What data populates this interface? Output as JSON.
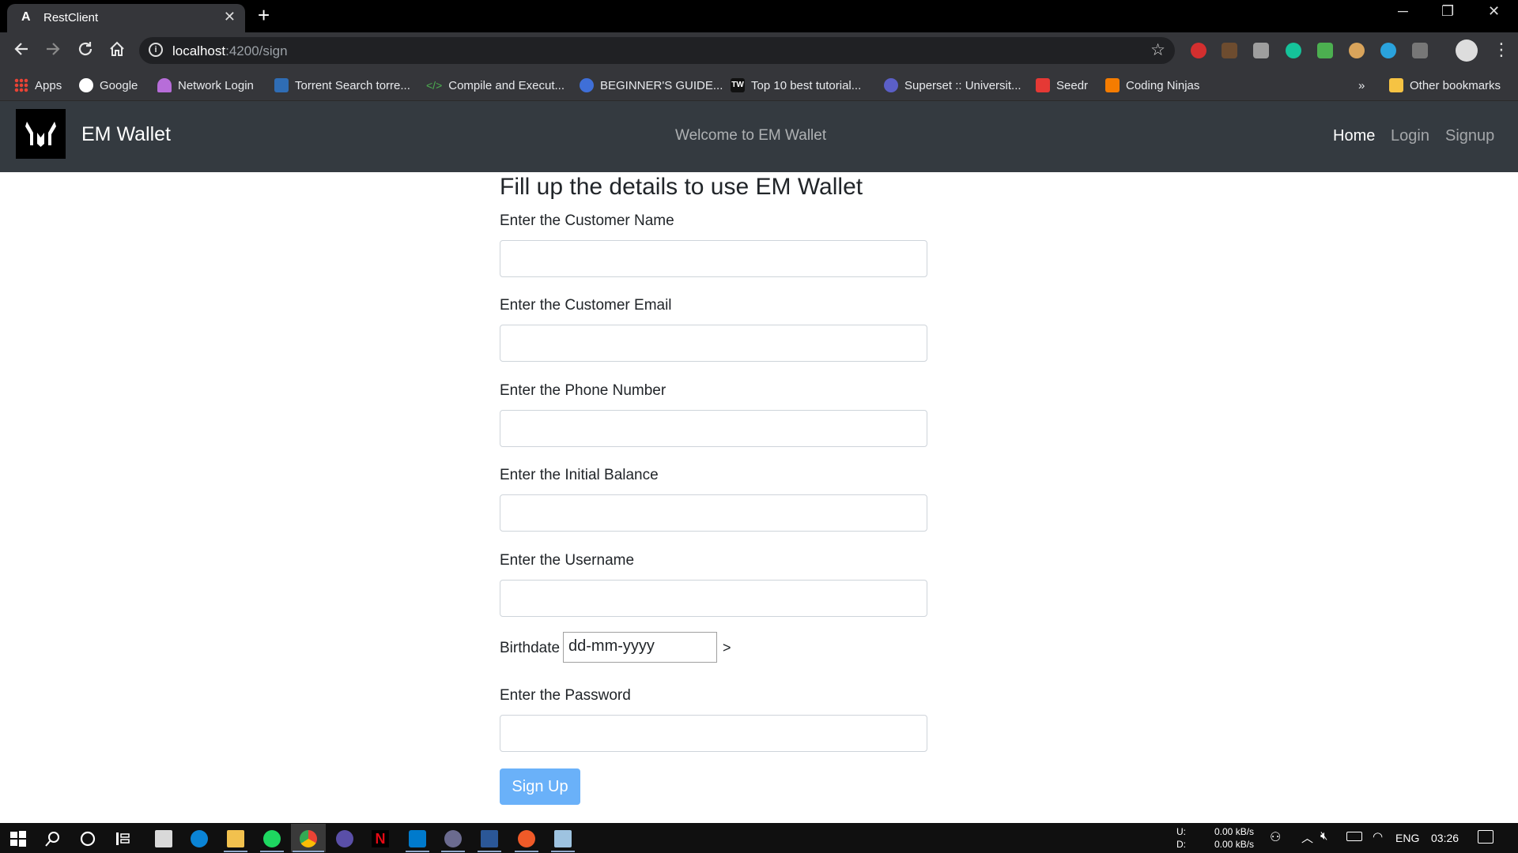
{
  "browser": {
    "tab_title": "RestClient",
    "tab_favicon": "A",
    "close_tab": "✕",
    "new_tab": "+",
    "url_host": "localhost",
    "url_path": ":4200/sign",
    "window_min": "─",
    "window_restore": "❐",
    "window_close": "✕"
  },
  "bookmarks": [
    {
      "label": "Apps"
    },
    {
      "label": "Google"
    },
    {
      "label": "Network Login"
    },
    {
      "label": "Torrent Search torre..."
    },
    {
      "label": "Compile and Execut..."
    },
    {
      "label": "BEGINNER'S GUIDE..."
    },
    {
      "label": "Top 10 best tutorial..."
    },
    {
      "label": "Superset :: Universit..."
    },
    {
      "label": "Seedr"
    },
    {
      "label": "Coding Ninjas"
    }
  ],
  "bookmarks_overflow": "»",
  "other_bookmarks": "Other bookmarks",
  "navbar": {
    "brand": "EM Wallet",
    "welcome": "Welcome to EM Wallet",
    "links": {
      "home": "Home",
      "login": "Login",
      "signup": "Signup"
    }
  },
  "form": {
    "title": "Fill up the details to use EM Wallet",
    "labels": {
      "name": "Enter the Customer Name",
      "email": "Enter the Customer Email",
      "phone": "Enter the Phone Number",
      "balance": "Enter the Initial Balance",
      "username": "Enter the Username",
      "birthdate": "Birthdate",
      "password": "Enter the Password"
    },
    "birthdate_placeholder": "dd-mm-yyyy",
    "stray_text": ">",
    "submit": "Sign Up"
  },
  "taskbar": {
    "net_up_label": "U:",
    "net_down_label": "D:",
    "net_up": "0.00 kB/s",
    "net_down": "0.00 kB/s",
    "language": "ENG",
    "time": "03:26"
  },
  "colors": {
    "navbar_bg": "#343a40",
    "button_bg": "#6ab1f9",
    "chrome_dark": "#35363a"
  }
}
